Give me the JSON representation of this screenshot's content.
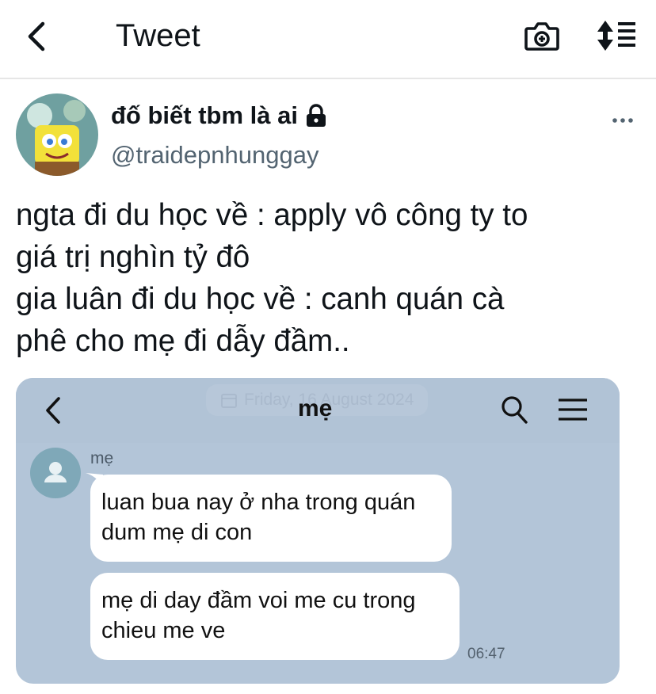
{
  "header": {
    "title": "Tweet",
    "back_icon": "chevron-left-icon",
    "camera_icon": "camera-plus-icon",
    "sort_icon": "sort-lines-icon"
  },
  "author": {
    "display_name": "đố biết tbm là ai",
    "handle": "@traidepnhunggay",
    "protected_icon": "lock-icon",
    "more_icon": "more-horizontal-icon"
  },
  "tweet": {
    "lines": [
      "ngta đi du học về : apply vô công ty to",
      "giá trị nghìn tỷ đô",
      "gia luân đi du học về : canh quán cà",
      "phê cho mẹ đi dẫy đầm.."
    ]
  },
  "media": {
    "chat_title": "mẹ",
    "date_stamp": "Friday, 16 August 2024",
    "sender_name": "mẹ",
    "messages": [
      {
        "lines": [
          "luan bua nay ở nha trong quán",
          "dum mẹ di con"
        ]
      },
      {
        "lines": [
          "mẹ di day đầm voi me cu trong",
          "chieu me ve"
        ]
      }
    ],
    "time": "06:47",
    "colors": {
      "background": "#b3c5d8",
      "bubble": "#ffffff",
      "avatar": "#7fa8b8"
    }
  },
  "colors": {
    "text": "#0f1419",
    "secondary": "#536471",
    "divider": "#e6e6e6"
  }
}
